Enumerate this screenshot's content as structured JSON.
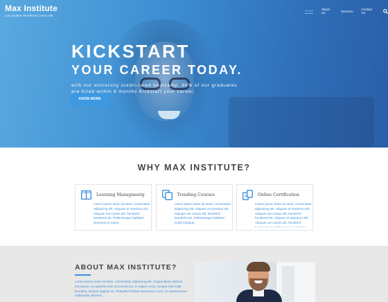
{
  "header": {
    "site_title": "Max Institute",
    "tagline": "Just another WordPress Demo site",
    "nav": [
      "Home",
      "About Us",
      "Services",
      "Contact Us"
    ],
    "active_nav": "Home",
    "search_icon": "search-icon"
  },
  "hero": {
    "line1": "KICKSTART",
    "line2": "YOUR CAREER TODAY.",
    "subtitle": "with our university credit-rated bootcamp. 88% of our graduates are hired within 6 months Kickstart your career.",
    "button": "KNOW MORE"
  },
  "why": {
    "title": "WHY MAX INSTITUTE?",
    "cards": [
      {
        "icon": "book-icon",
        "title": "Learning Managmentg",
        "text": "Lorem ipsum dolor sit amet, consectetur adipiscing elit. Aliquam et interdum elit. Aliquam vel cursus elit, hendrerit hendrerit est. Pellentesque habitant senectus et netus"
      },
      {
        "icon": "copy-icon",
        "title": "Trending Courses",
        "text": "Lorem ipsum dolor sit amet, consectetur adipiscing elit. Aliquam et interdum elit. Aliquam vel cursus elit, hendrerit hendrerit est. Pellentesque habitant morbi tristique."
      },
      {
        "icon": "certificate-icon",
        "title": "Online Certification",
        "text": "Lorem ipsum dolor sit amet, consectetur adipiscing elit. Aliquam et interdum elit. Aliquam vel cursus elit, hendrerit hendrerit est. Aliquam et interdum elit. Aliquam vel cursus elit, hendrerit hendrerit est. Pellentesque habitant morbi tristique. Aliquam vel cursus elit, hendrerit hendrerit est. Aliquam et interdum elit. Aliquam vel cursus elit, hendrerit hendrerit est. hendrerit est, Aliquam vel cursus elit, hendrerit hendrerit est. Lorem ipsum dolor sit amet. Pellentesque habitant, hendrerit aliquam fames ac turpis egestas."
      }
    ]
  },
  "about": {
    "title": "ABOUT MAX INSTITUTE?",
    "text": "Lorem ipsum dolor sit amet, consectetur adipiscing elit. Suspendisse ultrices nisi ipsum, eu egestas ante accumsan eu. In sapien urna, congue sed nulla faucibus, tempus sagittis mi. Phasellus finibus fermentum nunc, in viverra lorem sollicitudin placerat."
  },
  "colors": {
    "accent": "#3b8fdc",
    "hero_start": "#5aa9e0",
    "hero_end": "#2a5ea8",
    "button": "#3b9ae1",
    "about_bg": "#e8e8e8"
  }
}
